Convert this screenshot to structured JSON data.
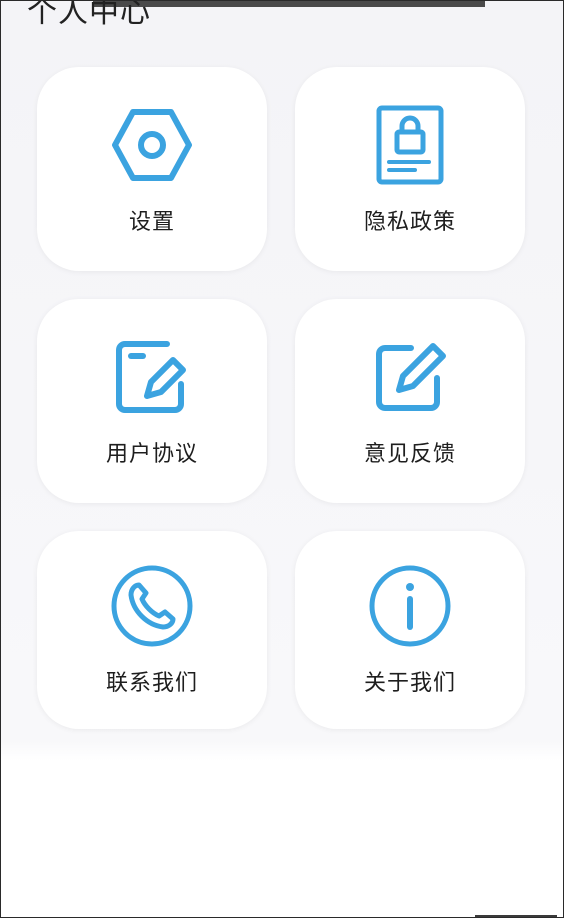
{
  "header": {
    "title": "个人中心"
  },
  "menu": {
    "items": [
      {
        "label": "设置",
        "icon": "settings-hexagon-icon"
      },
      {
        "label": "隐私政策",
        "icon": "privacy-lock-document-icon"
      },
      {
        "label": "用户协议",
        "icon": "user-agreement-edit-icon"
      },
      {
        "label": "意见反馈",
        "icon": "feedback-pencil-icon"
      },
      {
        "label": "联系我们",
        "icon": "phone-icon"
      },
      {
        "label": "关于我们",
        "icon": "info-icon"
      }
    ]
  },
  "colors": {
    "accent": "#3ba3e0",
    "text": "#1e1e1e",
    "background": "#f5f5f8",
    "card": "#ffffff"
  }
}
